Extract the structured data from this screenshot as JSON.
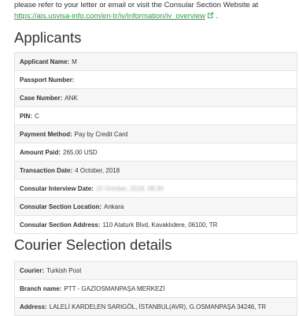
{
  "intro": {
    "line1": "please refer to your letter or email or visit the Consular Section Website at",
    "link": "https://ais.usvisa-info.com/en-tr/iv/information/iv_overview",
    "suffix": "."
  },
  "applicants": {
    "heading": "Applicants",
    "rows": [
      {
        "label": "Applicant Name:",
        "value": "M"
      },
      {
        "label": "Passport Number:",
        "value": ""
      },
      {
        "label": "Case Number:",
        "value": "ANK"
      },
      {
        "label": "PIN:",
        "value": "C"
      },
      {
        "label": "Payment Method:",
        "value": "Pay by Credit Card"
      },
      {
        "label": "Amount Paid:",
        "value": "265.00 USD"
      },
      {
        "label": "Transaction Date:",
        "value": "4 October, 2018"
      },
      {
        "label": "Consular Interview Date:",
        "value": "22 October, 2018, 08:30"
      },
      {
        "label": "Consular Section Location:",
        "value": "Ankara"
      },
      {
        "label": "Consular Section Address:",
        "value": "110 Ataturk Blvd, Kavaklıdere, 06100, TR"
      }
    ]
  },
  "courier": {
    "heading": "Courier Selection details",
    "rows": [
      {
        "label": "Courier:",
        "value": "Turkish Post"
      },
      {
        "label": "Branch name:",
        "value": "PTT - GAZİOSMANPAŞA MERKEZİ"
      },
      {
        "label": "Address:",
        "value": "LALELİ KARDELEN SARIGÖL, İSTANBUL(AVR), G.OSMANPAŞA 34246, TR"
      }
    ]
  }
}
